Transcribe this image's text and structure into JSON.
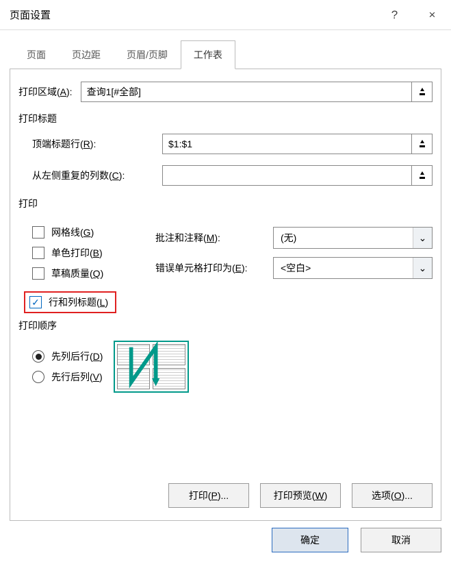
{
  "titlebar": {
    "title": "页面设置",
    "help": "?",
    "close": "×"
  },
  "tabs": {
    "page": "页面",
    "margins": "页边距",
    "header_footer": "页眉/页脚",
    "sheet": "工作表"
  },
  "print_area": {
    "label_pre": "打印区域(",
    "label_u": "A",
    "label_post": "):",
    "value": "查询1[#全部]"
  },
  "print_title": {
    "header": "打印标题",
    "top_rows_pre": "顶端标题行(",
    "top_rows_u": "R",
    "top_rows_post": "):",
    "top_rows_value": "$1:$1",
    "left_cols_pre": "从左侧重复的列数(",
    "left_cols_u": "C",
    "left_cols_post": "):",
    "left_cols_value": ""
  },
  "print_section": {
    "header": "打印",
    "gridlines_pre": "网格线(",
    "gridlines_u": "G",
    "gridlines_post": ")",
    "black_white_pre": "单色打印(",
    "black_white_u": "B",
    "black_white_post": ")",
    "draft_pre": "草稿质量(",
    "draft_u": "Q",
    "draft_post": ")",
    "rowcol_pre": "行和列标题(",
    "rowcol_u": "L",
    "rowcol_post": ")",
    "comments_label_pre": "批注和注释(",
    "comments_label_u": "M",
    "comments_label_post": "):",
    "comments_value": "(无)",
    "errors_label_pre": "错误单元格打印为(",
    "errors_label_u": "E",
    "errors_label_post": "):",
    "errors_value": "<空白>"
  },
  "page_order": {
    "header": "打印顺序",
    "down_over_pre": "先列后行(",
    "down_over_u": "D",
    "down_over_post": ")",
    "over_down_pre": "先行后列(",
    "over_down_u": "V",
    "over_down_post": ")"
  },
  "actions": {
    "print_pre": "打印(",
    "print_u": "P",
    "print_post": ")...",
    "preview_pre": "打印预览(",
    "preview_u": "W",
    "preview_post": ")",
    "options_pre": "选项(",
    "options_u": "O",
    "options_post": ")..."
  },
  "footer": {
    "ok": "确定",
    "cancel": "取消"
  }
}
